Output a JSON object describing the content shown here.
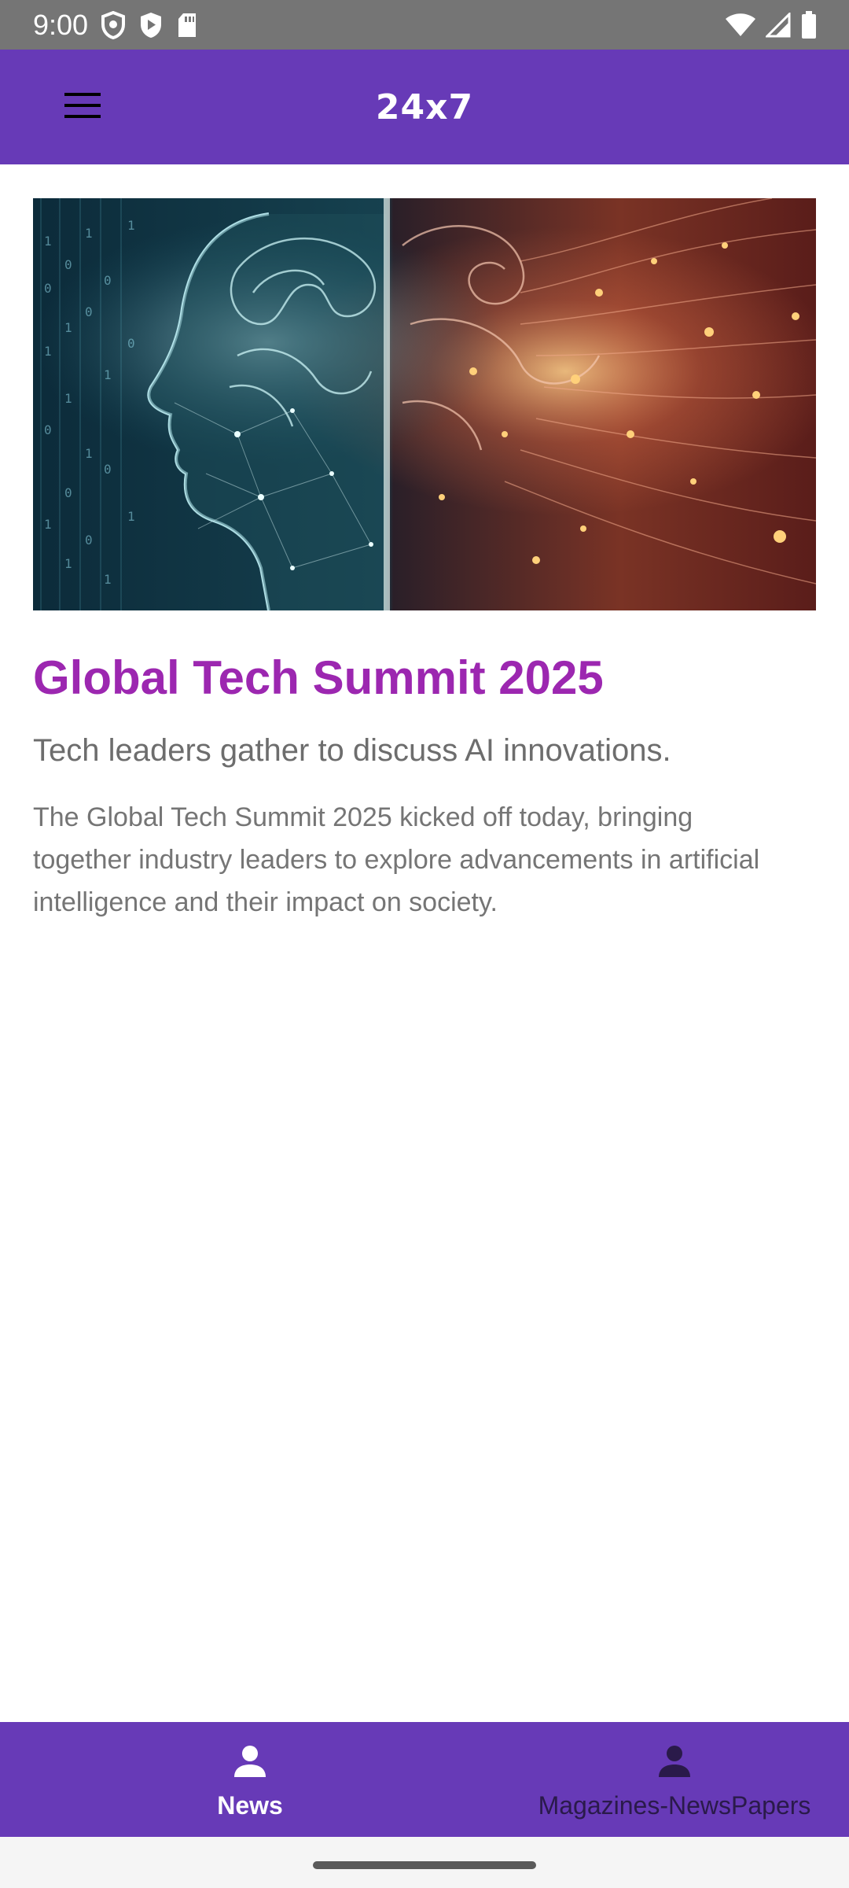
{
  "status_bar": {
    "time": "9:00",
    "icons": [
      "shield-icon",
      "play-protect-icon",
      "sd-card-icon",
      "wifi-icon",
      "signal-icon",
      "battery-icon"
    ]
  },
  "app_bar": {
    "title": "24x7",
    "menu_icon": "hamburger-menu-icon",
    "background": "#673ab7"
  },
  "article": {
    "image_description": "ai-brain-illustration",
    "title": "Global Tech Summit 2025",
    "subtitle": "Tech leaders gather to discuss AI innovations.",
    "body": "The Global Tech Summit 2025 kicked off today, bringing together industry leaders to explore advancements in artificial intelligence and their impact on society.",
    "title_color": "#9c27b0"
  },
  "bottom_nav": {
    "items": [
      {
        "label": "News",
        "icon": "person-icon",
        "active": true
      },
      {
        "label": "Magazines-NewsPapers",
        "icon": "person-icon",
        "active": false
      }
    ]
  }
}
